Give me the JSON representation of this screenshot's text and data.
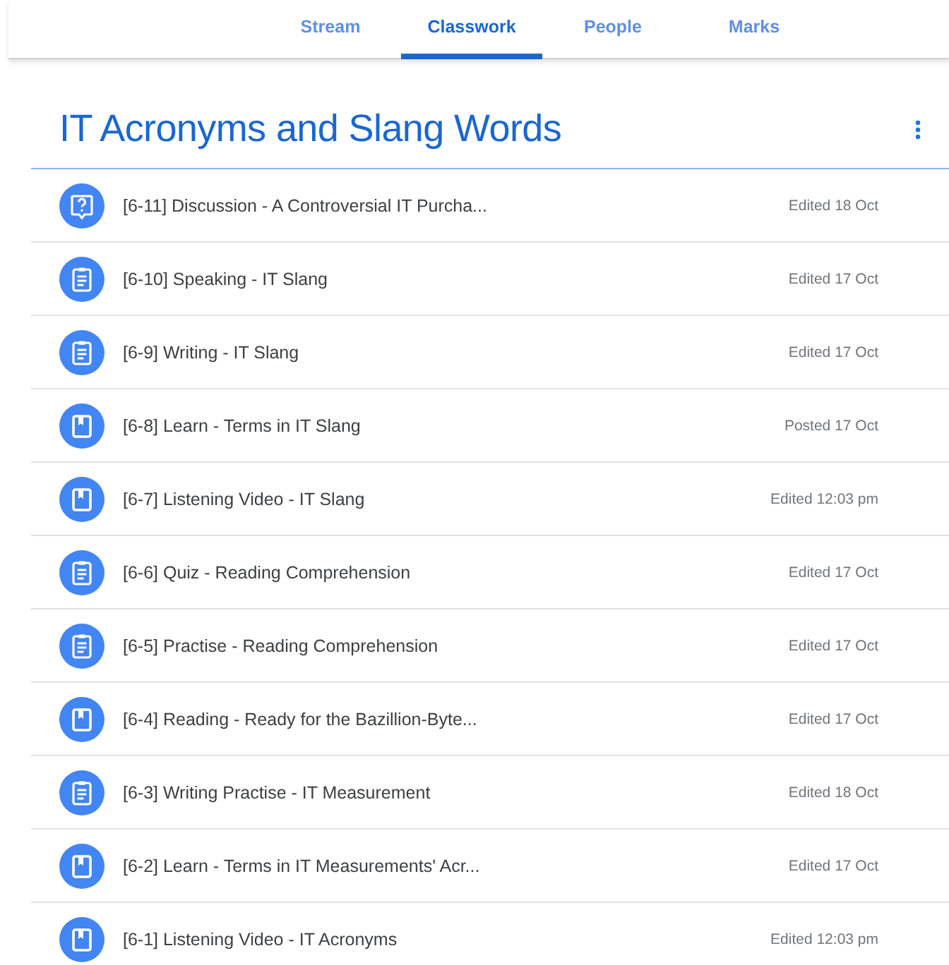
{
  "tabs": [
    {
      "label": "Stream",
      "selected": false
    },
    {
      "label": "Classwork",
      "selected": true
    },
    {
      "label": "People",
      "selected": false
    },
    {
      "label": "Marks",
      "selected": false
    }
  ],
  "topic": {
    "title": "IT Acronyms and Slang Words"
  },
  "items": [
    {
      "kind": "question",
      "title": "[6-11] Discussion - A Controversial IT Purcha...",
      "date": "Edited 18 Oct"
    },
    {
      "kind": "assignment",
      "title": "[6-10] Speaking - IT Slang",
      "date": "Edited 17 Oct"
    },
    {
      "kind": "assignment",
      "title": "[6-9] Writing - IT Slang",
      "date": "Edited 17 Oct"
    },
    {
      "kind": "material",
      "title": "[6-8] Learn - Terms in IT Slang",
      "date": "Posted 17 Oct"
    },
    {
      "kind": "material",
      "title": "[6-7] Listening Video - IT Slang",
      "date": "Edited 12:03 pm"
    },
    {
      "kind": "assignment",
      "title": "[6-6] Quiz - Reading Comprehension",
      "date": "Edited 17 Oct"
    },
    {
      "kind": "assignment",
      "title": "[6-5] Practise - Reading Comprehension",
      "date": "Edited 17 Oct"
    },
    {
      "kind": "material",
      "title": "[6-4] Reading - Ready for the Bazillion-Byte...",
      "date": "Edited 17 Oct"
    },
    {
      "kind": "assignment",
      "title": "[6-3] Writing Practise - IT Measurement",
      "date": "Edited 18 Oct"
    },
    {
      "kind": "material",
      "title": "[6-2] Learn - Terms in IT Measurements' Acr...",
      "date": "Edited 17 Oct"
    },
    {
      "kind": "material",
      "title": "[6-1] Listening Video - IT Acronyms",
      "date": "Edited 12:03 pm"
    }
  ]
}
